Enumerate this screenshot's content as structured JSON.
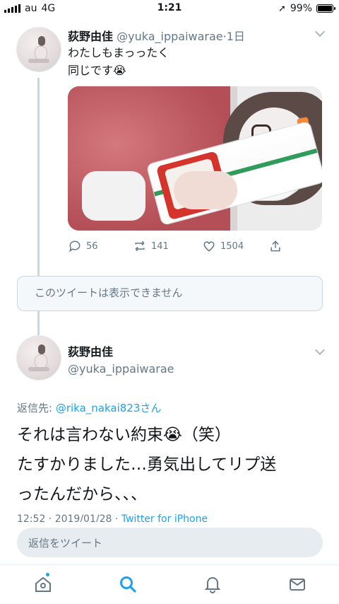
{
  "status_bar": {
    "carrier": "au",
    "network": "4G",
    "time": "1:21",
    "battery": "99%"
  },
  "parent_tweet": {
    "name": "荻野由佳",
    "handle": "@yuka_ippaiwarae",
    "age": "·1日",
    "text_line1": "わたしもまっったく",
    "text_line2": "同じです😭",
    "photo_icon": "photo-cup-noodle-selfie",
    "stats": {
      "replies": "56",
      "retweets": "141",
      "likes": "1504"
    }
  },
  "unavailable_notice": "このツイートは表示できません",
  "focused_tweet": {
    "name": "荻野由佳",
    "handle": "@yuka_ippaiwarae",
    "reply_prefix": "返信先: ",
    "reply_to": "@rika_nakai823さん",
    "text_line1": "それは言わない約束😭（笑）",
    "text_line2": "たすかりました…勇気出してリプ送",
    "text_line3": "ったんだから、、、",
    "timestamp": "12:52 · 2019/01/28 · ",
    "source": "Twitter for iPhone"
  },
  "reply_box": {
    "placeholder": "返信をツイート"
  },
  "tab_bar": {
    "items": [
      "home-icon",
      "search-icon",
      "notifications-icon",
      "messages-icon"
    ],
    "active": "search-icon",
    "accent": "#1da1f2"
  }
}
